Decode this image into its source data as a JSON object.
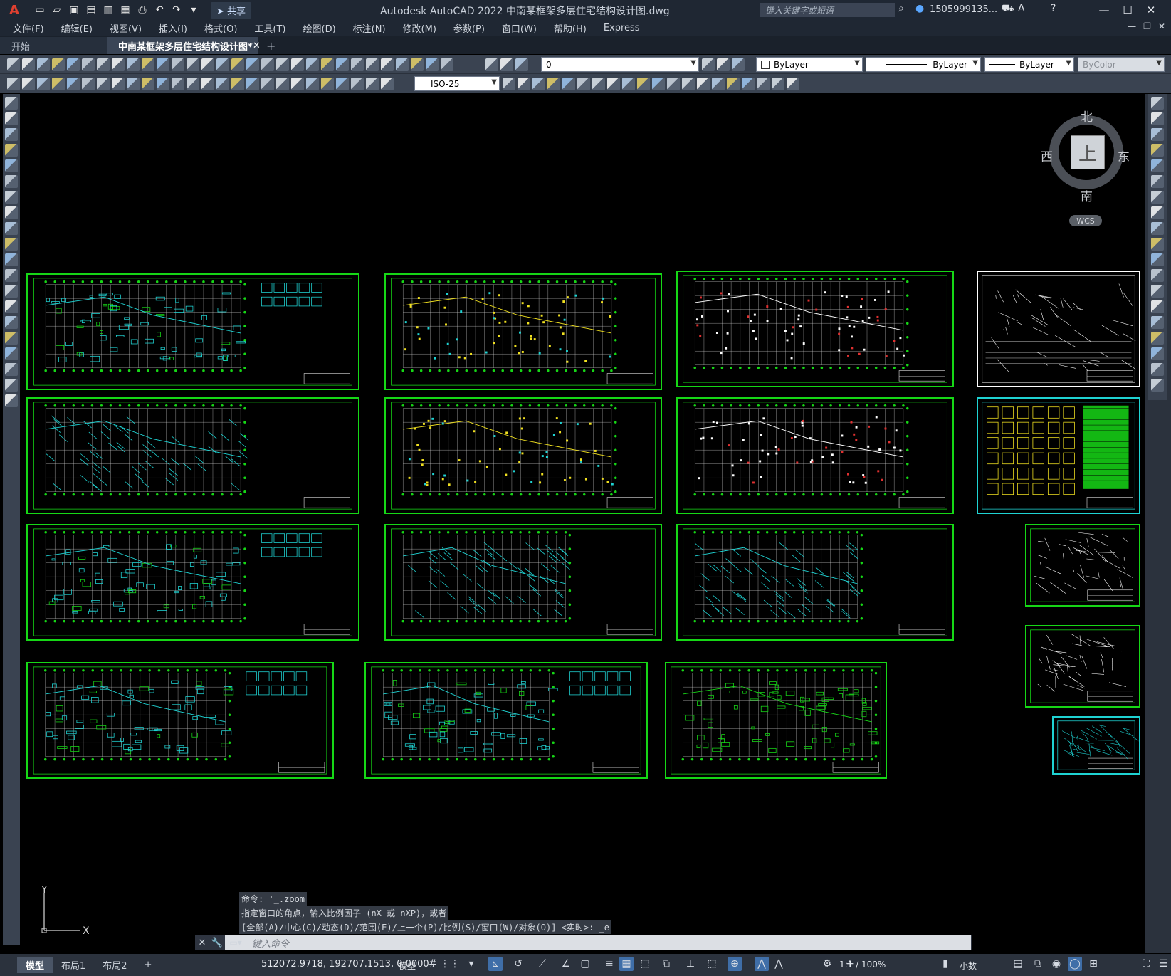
{
  "app": {
    "logo": "A",
    "title": "Autodesk AutoCAD 2022    中南某框架多层住宅结构设计图.dwg",
    "share_label": "共享",
    "search_placeholder": "键入关键字或短语",
    "user": "1505999135...",
    "colors": {
      "frame_green": "#16d716",
      "cyan": "#1fd3d3",
      "yellow": "#f0e020",
      "accent": "#3f6ea8"
    }
  },
  "menu": [
    "文件(F)",
    "编辑(E)",
    "视图(V)",
    "插入(I)",
    "格式(O)",
    "工具(T)",
    "绘图(D)",
    "标注(N)",
    "修改(M)",
    "参数(P)",
    "窗口(W)",
    "帮助(H)",
    "Express"
  ],
  "tabs": {
    "start": "开始",
    "active": "中南某框架多层住宅结构设计图*",
    "close": "✕",
    "add": "+"
  },
  "toolbars": {
    "layer_value": "0",
    "color": "ByLayer",
    "linetype": "ByLayer",
    "lineweight": "ByLayer",
    "plotstyle": "ByColor",
    "dimstyle": "ISO-25"
  },
  "viewcube": {
    "north": "北",
    "south": "南",
    "east": "东",
    "west": "西",
    "top": "上",
    "wcs": "WCS"
  },
  "ucs": {
    "y": "Y",
    "x": "X"
  },
  "command": {
    "history": [
      "命令: '_.zoom",
      "指定窗口的角点，输入比例因子 (nX 或 nXP)，或者",
      "[全部(A)/中心(C)/动态(D)/范围(E)/上一个(P)/比例(S)/窗口(W)/对象(O)] <实时>: _e"
    ],
    "placeholder": "键入命令"
  },
  "status": {
    "layouts": [
      "模型",
      "布局1",
      "布局2"
    ],
    "add_layout": "+",
    "coords": "512072.9718, 192707.1513, 0.0000",
    "space": "模型",
    "scale": "1:1 / 100%",
    "units": "小数"
  }
}
